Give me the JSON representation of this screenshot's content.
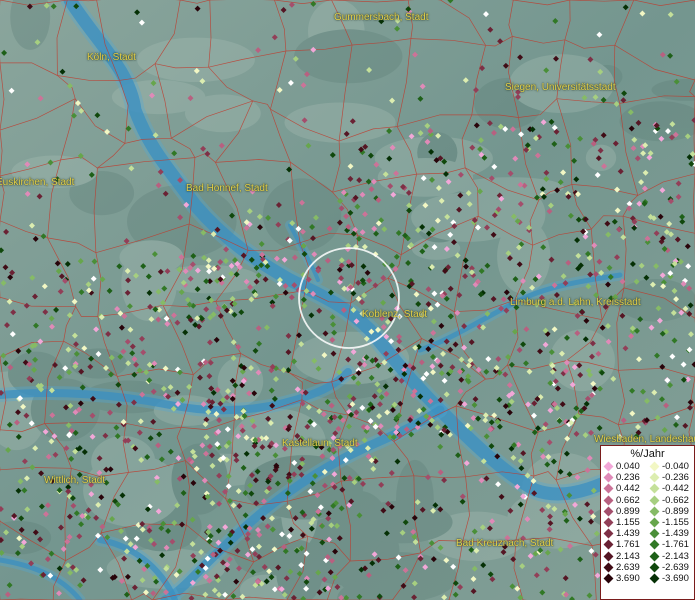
{
  "map": {
    "cities": [
      {
        "name": "Gummersbach, Stadt"
      },
      {
        "name": "Köln, Stadt"
      },
      {
        "name": "Siegen, Universitätsstadt"
      },
      {
        "name": "Euskirchen, Stadt"
      },
      {
        "name": "Bad Honnef, Stadt"
      },
      {
        "name": "Koblenz, Stadt"
      },
      {
        "name": "Limburg a.d. Lahn, Kreisstadt"
      },
      {
        "name": "Kastellaun, Stadt"
      },
      {
        "name": "Wittlich, Stadt"
      },
      {
        "name": "Bad Kreuznach, Stadt"
      },
      {
        "name": "Wiesbaden, Landeshauptstadt"
      }
    ],
    "colors": {
      "terrain": "#7a9a92",
      "river": "#3b8fc0",
      "borders": "#c0392b",
      "label": "#e3d04a",
      "focus_ring": "#ffffff"
    }
  },
  "legend": {
    "title": "%/Jahr",
    "rows": [
      {
        "pos": "0.040",
        "pos_color": "#f2a7d8",
        "neg": "-0.040",
        "neg_color": "#f2f7c4"
      },
      {
        "pos": "0.236",
        "pos_color": "#e08ab8",
        "neg": "-0.236",
        "neg_color": "#dcedb0"
      },
      {
        "pos": "0.442",
        "pos_color": "#cc7398",
        "neg": "-0.442",
        "neg_color": "#c4e09a"
      },
      {
        "pos": "0.662",
        "pos_color": "#b86080",
        "neg": "-0.662",
        "neg_color": "#a6cf80"
      },
      {
        "pos": "0.899",
        "pos_color": "#a44e6c",
        "neg": "-0.899",
        "neg_color": "#86bb66"
      },
      {
        "pos": "1.155",
        "pos_color": "#923f58",
        "neg": "-1.155",
        "neg_color": "#67a64c"
      },
      {
        "pos": "1.439",
        "pos_color": "#7e3046",
        "neg": "-1.439",
        "neg_color": "#4a8f38"
      },
      {
        "pos": "1.761",
        "pos_color": "#6a2234",
        "neg": "-1.761",
        "neg_color": "#317826"
      },
      {
        "pos": "2.143",
        "pos_color": "#551624",
        "neg": "-2.143",
        "neg_color": "#1e6018"
      },
      {
        "pos": "2.639",
        "pos_color": "#400c16",
        "neg": "-2.639",
        "neg_color": "#10480c"
      },
      {
        "pos": "3.690",
        "pos_color": "#28040a",
        "neg": "-3.690",
        "neg_color": "#053005"
      }
    ]
  }
}
